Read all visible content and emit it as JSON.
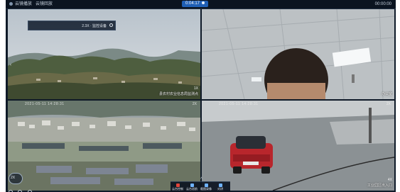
{
  "topbar": {
    "left_item_1": "云镜播放",
    "left_item_2": "云镜回放",
    "clock": "0:04:17",
    "right_text": "00:00:00"
  },
  "panes": [
    {
      "id": "p1",
      "label": "县农村农业信息局监测点",
      "right_tag": "1X",
      "ptz_text": "2.3X · 监控设备"
    },
    {
      "id": "p2",
      "label": "办公室",
      "right_tag": "1X"
    },
    {
      "id": "p3",
      "timestamp": "2021-05-11 14:28:31",
      "top_right": "2X",
      "label": ""
    },
    {
      "id": "p4",
      "timestamp": "2021-05-11 14:28:31",
      "top_right": "2X",
      "label": "工业园区出入口",
      "overlay_tag": "4X"
    }
  ],
  "dock": {
    "items": [
      {
        "label": "云台控制",
        "icon": "record-icon",
        "color": "#e0453a"
      },
      {
        "label": "云台巡航",
        "icon": "cruise-icon",
        "color": "#6fb3ff"
      },
      {
        "label": "截图录像",
        "icon": "capture-icon",
        "color": "#6fb3ff"
      },
      {
        "label": "对讲",
        "icon": "mic-icon",
        "color": "#6fb3ff"
      }
    ]
  },
  "zoom_control": {
    "value": "2X"
  },
  "colors": {
    "accent": "#1f5fb5",
    "background": "#0f1a28"
  }
}
